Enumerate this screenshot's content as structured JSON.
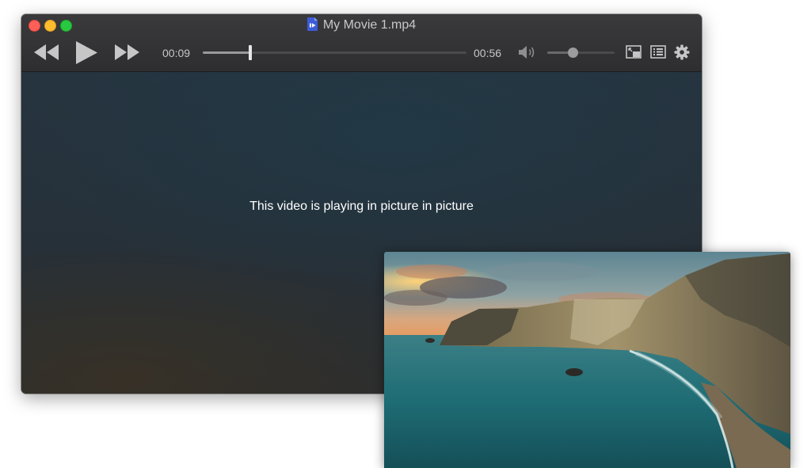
{
  "window": {
    "title": "My Movie 1.mp4",
    "title_icon": "video-document-icon"
  },
  "controls": {
    "rewind_icon": "rewind-icon",
    "play_icon": "play-icon",
    "forward_icon": "fast-forward-icon",
    "elapsed_time": "00:09",
    "total_time": "00:56",
    "seek_progress": 0.18,
    "volume_icon": "speaker-volume-icon",
    "volume_level": 0.38,
    "pip_icon": "picture-in-picture-icon",
    "playlist_icon": "playlist-icon",
    "settings_icon": "gear-icon"
  },
  "video": {
    "message": "This video is playing in picture in picture"
  },
  "pip": {
    "content": "coastal cliffs at sunset"
  },
  "colors": {
    "close": "#fe5f57",
    "minimize": "#febc2e",
    "zoom": "#28c840",
    "doc_icon": "#3d5bd9"
  }
}
